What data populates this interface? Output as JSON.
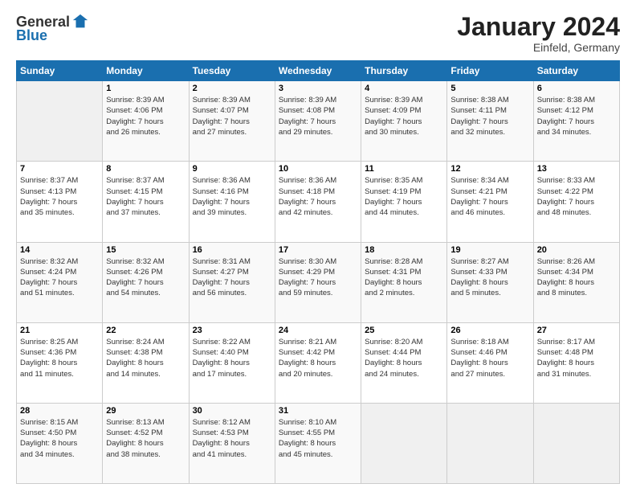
{
  "logo": {
    "general": "General",
    "blue": "Blue"
  },
  "title": "January 2024",
  "subtitle": "Einfeld, Germany",
  "days": [
    "Sunday",
    "Monday",
    "Tuesday",
    "Wednesday",
    "Thursday",
    "Friday",
    "Saturday"
  ],
  "weeks": [
    [
      {
        "num": "",
        "info": ""
      },
      {
        "num": "1",
        "info": "Sunrise: 8:39 AM\nSunset: 4:06 PM\nDaylight: 7 hours\nand 26 minutes."
      },
      {
        "num": "2",
        "info": "Sunrise: 8:39 AM\nSunset: 4:07 PM\nDaylight: 7 hours\nand 27 minutes."
      },
      {
        "num": "3",
        "info": "Sunrise: 8:39 AM\nSunset: 4:08 PM\nDaylight: 7 hours\nand 29 minutes."
      },
      {
        "num": "4",
        "info": "Sunrise: 8:39 AM\nSunset: 4:09 PM\nDaylight: 7 hours\nand 30 minutes."
      },
      {
        "num": "5",
        "info": "Sunrise: 8:38 AM\nSunset: 4:11 PM\nDaylight: 7 hours\nand 32 minutes."
      },
      {
        "num": "6",
        "info": "Sunrise: 8:38 AM\nSunset: 4:12 PM\nDaylight: 7 hours\nand 34 minutes."
      }
    ],
    [
      {
        "num": "7",
        "info": "Sunrise: 8:37 AM\nSunset: 4:13 PM\nDaylight: 7 hours\nand 35 minutes."
      },
      {
        "num": "8",
        "info": "Sunrise: 8:37 AM\nSunset: 4:15 PM\nDaylight: 7 hours\nand 37 minutes."
      },
      {
        "num": "9",
        "info": "Sunrise: 8:36 AM\nSunset: 4:16 PM\nDaylight: 7 hours\nand 39 minutes."
      },
      {
        "num": "10",
        "info": "Sunrise: 8:36 AM\nSunset: 4:18 PM\nDaylight: 7 hours\nand 42 minutes."
      },
      {
        "num": "11",
        "info": "Sunrise: 8:35 AM\nSunset: 4:19 PM\nDaylight: 7 hours\nand 44 minutes."
      },
      {
        "num": "12",
        "info": "Sunrise: 8:34 AM\nSunset: 4:21 PM\nDaylight: 7 hours\nand 46 minutes."
      },
      {
        "num": "13",
        "info": "Sunrise: 8:33 AM\nSunset: 4:22 PM\nDaylight: 7 hours\nand 48 minutes."
      }
    ],
    [
      {
        "num": "14",
        "info": "Sunrise: 8:32 AM\nSunset: 4:24 PM\nDaylight: 7 hours\nand 51 minutes."
      },
      {
        "num": "15",
        "info": "Sunrise: 8:32 AM\nSunset: 4:26 PM\nDaylight: 7 hours\nand 54 minutes."
      },
      {
        "num": "16",
        "info": "Sunrise: 8:31 AM\nSunset: 4:27 PM\nDaylight: 7 hours\nand 56 minutes."
      },
      {
        "num": "17",
        "info": "Sunrise: 8:30 AM\nSunset: 4:29 PM\nDaylight: 7 hours\nand 59 minutes."
      },
      {
        "num": "18",
        "info": "Sunrise: 8:28 AM\nSunset: 4:31 PM\nDaylight: 8 hours\nand 2 minutes."
      },
      {
        "num": "19",
        "info": "Sunrise: 8:27 AM\nSunset: 4:33 PM\nDaylight: 8 hours\nand 5 minutes."
      },
      {
        "num": "20",
        "info": "Sunrise: 8:26 AM\nSunset: 4:34 PM\nDaylight: 8 hours\nand 8 minutes."
      }
    ],
    [
      {
        "num": "21",
        "info": "Sunrise: 8:25 AM\nSunset: 4:36 PM\nDaylight: 8 hours\nand 11 minutes."
      },
      {
        "num": "22",
        "info": "Sunrise: 8:24 AM\nSunset: 4:38 PM\nDaylight: 8 hours\nand 14 minutes."
      },
      {
        "num": "23",
        "info": "Sunrise: 8:22 AM\nSunset: 4:40 PM\nDaylight: 8 hours\nand 17 minutes."
      },
      {
        "num": "24",
        "info": "Sunrise: 8:21 AM\nSunset: 4:42 PM\nDaylight: 8 hours\nand 20 minutes."
      },
      {
        "num": "25",
        "info": "Sunrise: 8:20 AM\nSunset: 4:44 PM\nDaylight: 8 hours\nand 24 minutes."
      },
      {
        "num": "26",
        "info": "Sunrise: 8:18 AM\nSunset: 4:46 PM\nDaylight: 8 hours\nand 27 minutes."
      },
      {
        "num": "27",
        "info": "Sunrise: 8:17 AM\nSunset: 4:48 PM\nDaylight: 8 hours\nand 31 minutes."
      }
    ],
    [
      {
        "num": "28",
        "info": "Sunrise: 8:15 AM\nSunset: 4:50 PM\nDaylight: 8 hours\nand 34 minutes."
      },
      {
        "num": "29",
        "info": "Sunrise: 8:13 AM\nSunset: 4:52 PM\nDaylight: 8 hours\nand 38 minutes."
      },
      {
        "num": "30",
        "info": "Sunrise: 8:12 AM\nSunset: 4:53 PM\nDaylight: 8 hours\nand 41 minutes."
      },
      {
        "num": "31",
        "info": "Sunrise: 8:10 AM\nSunset: 4:55 PM\nDaylight: 8 hours\nand 45 minutes."
      },
      {
        "num": "",
        "info": ""
      },
      {
        "num": "",
        "info": ""
      },
      {
        "num": "",
        "info": ""
      }
    ]
  ]
}
